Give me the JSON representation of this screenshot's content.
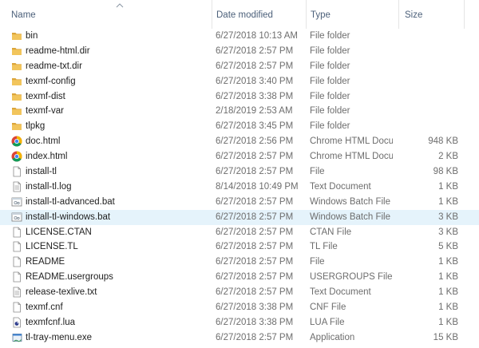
{
  "columns": {
    "name": "Name",
    "date": "Date modified",
    "type": "Type",
    "size": "Size"
  },
  "files": [
    {
      "name": "bin",
      "date": "6/27/2018 10:13 AM",
      "type": "File folder",
      "size": "",
      "icon": "folder-icon",
      "selected": false
    },
    {
      "name": "readme-html.dir",
      "date": "6/27/2018 2:57 PM",
      "type": "File folder",
      "size": "",
      "icon": "folder-icon",
      "selected": false
    },
    {
      "name": "readme-txt.dir",
      "date": "6/27/2018 2:57 PM",
      "type": "File folder",
      "size": "",
      "icon": "folder-icon",
      "selected": false
    },
    {
      "name": "texmf-config",
      "date": "6/27/2018 3:40 PM",
      "type": "File folder",
      "size": "",
      "icon": "folder-icon",
      "selected": false
    },
    {
      "name": "texmf-dist",
      "date": "6/27/2018 3:38 PM",
      "type": "File folder",
      "size": "",
      "icon": "folder-icon",
      "selected": false
    },
    {
      "name": "texmf-var",
      "date": "2/18/2019 2:53 AM",
      "type": "File folder",
      "size": "",
      "icon": "folder-icon",
      "selected": false
    },
    {
      "name": "tlpkg",
      "date": "6/27/2018 3:45 PM",
      "type": "File folder",
      "size": "",
      "icon": "folder-icon",
      "selected": false
    },
    {
      "name": "doc.html",
      "date": "6/27/2018 2:56 PM",
      "type": "Chrome HTML Docu...",
      "size": "948 KB",
      "icon": "chrome-icon",
      "selected": false
    },
    {
      "name": "index.html",
      "date": "6/27/2018 2:57 PM",
      "type": "Chrome HTML Docu...",
      "size": "2 KB",
      "icon": "chrome-icon",
      "selected": false
    },
    {
      "name": "install-tl",
      "date": "6/27/2018 2:57 PM",
      "type": "File",
      "size": "98 KB",
      "icon": "file-icon",
      "selected": false
    },
    {
      "name": "install-tl.log",
      "date": "8/14/2018 10:49 PM",
      "type": "Text Document",
      "size": "1 KB",
      "icon": "text-file-icon",
      "selected": false
    },
    {
      "name": "install-tl-advanced.bat",
      "date": "6/27/2018 2:57 PM",
      "type": "Windows Batch File",
      "size": "1 KB",
      "icon": "batch-file-icon",
      "selected": false
    },
    {
      "name": "install-tl-windows.bat",
      "date": "6/27/2018 2:57 PM",
      "type": "Windows Batch File",
      "size": "3 KB",
      "icon": "batch-file-icon",
      "selected": true
    },
    {
      "name": "LICENSE.CTAN",
      "date": "6/27/2018 2:57 PM",
      "type": "CTAN File",
      "size": "3 KB",
      "icon": "file-icon",
      "selected": false
    },
    {
      "name": "LICENSE.TL",
      "date": "6/27/2018 2:57 PM",
      "type": "TL File",
      "size": "5 KB",
      "icon": "file-icon",
      "selected": false
    },
    {
      "name": "README",
      "date": "6/27/2018 2:57 PM",
      "type": "File",
      "size": "1 KB",
      "icon": "file-icon",
      "selected": false
    },
    {
      "name": "README.usergroups",
      "date": "6/27/2018 2:57 PM",
      "type": "USERGROUPS File",
      "size": "1 KB",
      "icon": "file-icon",
      "selected": false
    },
    {
      "name": "release-texlive.txt",
      "date": "6/27/2018 2:57 PM",
      "type": "Text Document",
      "size": "1 KB",
      "icon": "text-file-icon",
      "selected": false
    },
    {
      "name": "texmf.cnf",
      "date": "6/27/2018 3:38 PM",
      "type": "CNF File",
      "size": "1 KB",
      "icon": "file-icon",
      "selected": false
    },
    {
      "name": "texmfcnf.lua",
      "date": "6/27/2018 3:38 PM",
      "type": "LUA File",
      "size": "1 KB",
      "icon": "lua-file-icon",
      "selected": false
    },
    {
      "name": "tl-tray-menu.exe",
      "date": "6/27/2018 2:57 PM",
      "type": "Application",
      "size": "15 KB",
      "icon": "application-icon",
      "selected": false
    }
  ],
  "colors": {
    "header_text": "#4c607a",
    "selected_row": "#e5f3fb",
    "folder": "#e8b43c"
  }
}
